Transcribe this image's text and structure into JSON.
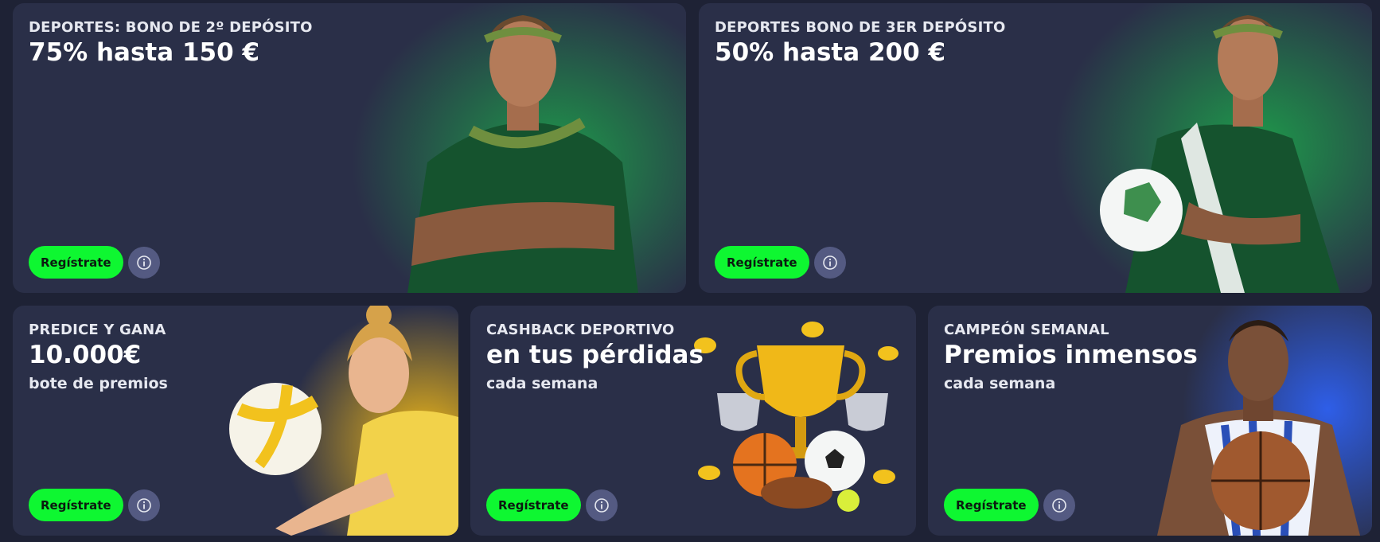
{
  "cards": [
    {
      "subtitle": "DEPORTES: BONO DE 2º DEPÓSITO",
      "title": "75% hasta 150 €",
      "cta_label": "Regístrate",
      "info_icon": "info-icon",
      "illustration": "athlete-laurel-wreath-arms-crossed"
    },
    {
      "subtitle": "DEPORTES BONO DE 3ER DEPÓSITO",
      "title": "50% hasta 200 €",
      "cta_label": "Regístrate",
      "info_icon": "info-icon",
      "illustration": "athlete-laurel-wreath-soccer-ball"
    },
    {
      "subtitle": "PREDICE Y GANA",
      "title": "10.000€",
      "tagline": "bote de premios",
      "cta_label": "Regístrate",
      "info_icon": "info-icon",
      "illustration": "volleyball-player"
    },
    {
      "subtitle": "CASHBACK DEPORTIVO",
      "title": "en tus pérdidas",
      "tagline": "cada semana",
      "cta_label": "Regístrate",
      "info_icon": "info-icon",
      "illustration": "trophy-with-sports-balls"
    },
    {
      "subtitle": "CAMPEÓN SEMANAL",
      "title": "Premios inmensos",
      "tagline": "cada semana",
      "cta_label": "Regístrate",
      "info_icon": "info-icon",
      "illustration": "basketball-player"
    }
  ],
  "colors": {
    "page_background": "#1e2235",
    "card_background": "#2a2f48",
    "cta_green": "#0ef731",
    "info_button": "#545a82",
    "accent_green_glow": "#1e9a4a",
    "accent_yellow_glow": "#f0b818",
    "accent_blue_glow": "#2e5ee8"
  }
}
